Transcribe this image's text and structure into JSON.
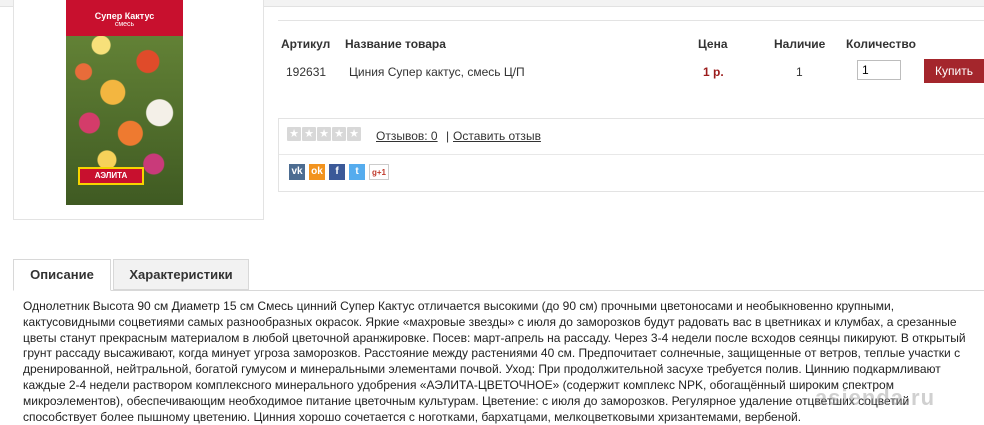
{
  "product_image": {
    "pack_title": "Супер Кактус",
    "pack_subtitle": "смесь",
    "pack_logo": "АЭЛИТА"
  },
  "table": {
    "headers": [
      "Артикул",
      "Название товара",
      "Цена",
      "Наличие",
      "Количество"
    ],
    "row": {
      "article": "192631",
      "name": "Циния Супер кактус, смесь Ц/П",
      "price": "1 р.",
      "stock": "1",
      "quantity": "1"
    },
    "buy_label": "Купить"
  },
  "reviews": {
    "rating_stars": 0,
    "rating_max": 5,
    "reviews_link": "Отзывов: 0",
    "separator": "|",
    "leave_review": "Оставить отзыв"
  },
  "share": {
    "icons": [
      "vk-icon",
      "odnoklassniki-icon",
      "facebook-icon",
      "twitter-icon",
      "google-plus-icon"
    ],
    "gplus_label": "g+1"
  },
  "tabs": [
    {
      "label": "Описание",
      "active": true
    },
    {
      "label": "Характеристики",
      "active": false
    }
  ],
  "description": "Однолетник Высота 90 см Диаметр 15 см Смесь цинний Супер Кактус отличается высокими (до 90 см) прочными цветоносами и необыкновенно крупными, кактусовидными соцветиями самых разнообразных окрасок. Яркие «махровые звезды» с июля до заморозков будут радовать вас в цветниках и клумбах, а срезанные цветы станут прекрасным материалом в любой цветочной аранжировке. Посев: март-апрель на рассаду. Через 3-4 недели после всходов сеянцы пикируют. В открытый грунт рассаду высаживают, когда минует угроза заморозков. Расстояние между растениями 40 см. Предпочитает солнечные, защищенные от ветров, теплые участки с дренированной, нейтральной, богатой гумусом и минеральными элементами почвой. Уход: При продолжительной засухе требуется полив. Циннию подкармливают каждые 2-4 недели раствором комплексного минерального удобрения «АЭЛИТА-ЦВЕТОЧНОЕ» (содержит комплекс NPK, обогащённый широким спектром микроэлементов), обеспечивающим необходимое питание цветочным культурам. Цветение: с июля до заморозков. Регулярное удаление отцветших соцветий способствует более пышному цветению. Цинния хорошо сочетается с ноготками, бархатцами, мелкоцветковыми хризантемами, вербеной.",
  "watermark": "asienda.ru",
  "colors": {
    "price": "#9b1b1b",
    "buy_button": "#a4262c"
  }
}
